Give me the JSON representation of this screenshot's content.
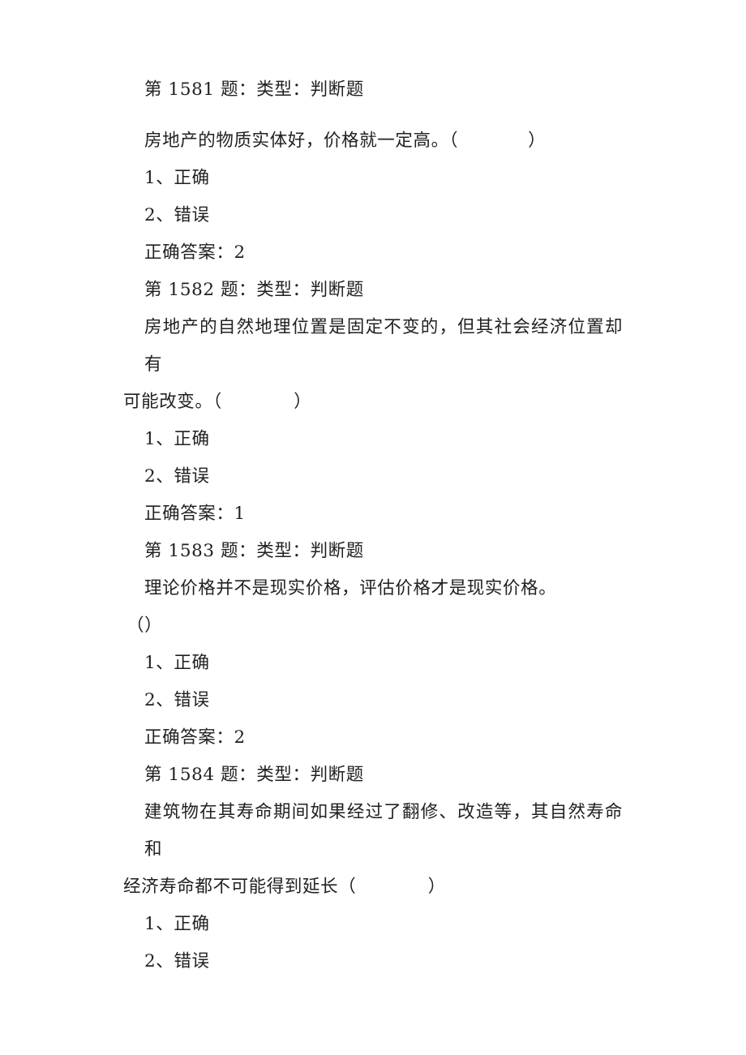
{
  "document": {
    "type": "exam-question-list",
    "subject_hint": "房地产估价 判断题",
    "questions": [
      {
        "header": "第 1581 题：类型：判断题",
        "body_lines": [
          "房地产的物质实体好，价格就一定高。（",
          "）"
        ],
        "body_single_line": true,
        "body": "房地产的物质实体好，价格就一定高。（　　　　）",
        "options": [
          "1、正确",
          "2、错误"
        ],
        "answer_label": "正确答案：2",
        "answer_value": "2"
      },
      {
        "header": "第 1582 题：类型：判断题",
        "body_line1": "房地产的自然地理位置是固定不变的，但其社会经济位置却有",
        "body_line2": "可能改变。（　　　　）",
        "body": "房地产的自然地理位置是固定不变的，但其社会经济位置却有可能改变。（　　　　）",
        "options": [
          "1、正确",
          "2、错误"
        ],
        "answer_label": "正确答案：1",
        "answer_value": "1"
      },
      {
        "header": "第 1583 题：类型：判断题",
        "body_line1": "理论价格并不是现实价格，评估价格才是现实价格。",
        "body_line2": "（）",
        "body": "理论价格并不是现实价格，评估价格才是现实价格。（）",
        "options": [
          "1、正确",
          "2、错误"
        ],
        "answer_label": "正确答案：2",
        "answer_value": "2"
      },
      {
        "header": "第 1584 题：类型：判断题",
        "body_line1": "建筑物在其寿命期间如果经过了翻修、改造等，其自然寿命和",
        "body_line2": "经济寿命都不可能得到延长（　　　　）",
        "body": "建筑物在其寿命期间如果经过了翻修、改造等，其自然寿命和经济寿命都不可能得到延长（　　　　）",
        "options": [
          "1、正确",
          "2、错误"
        ],
        "answer_label": "",
        "answer_value": ""
      }
    ]
  }
}
